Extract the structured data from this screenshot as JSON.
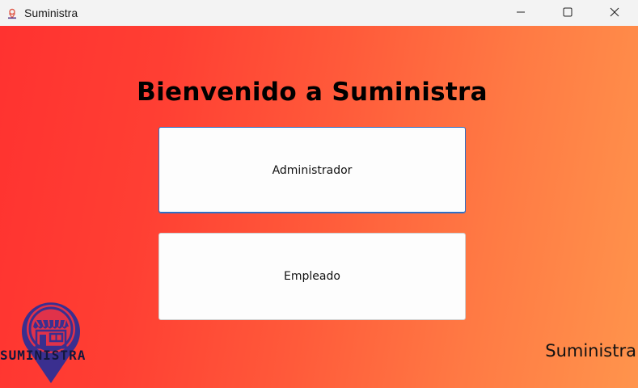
{
  "window": {
    "title": "Suministra",
    "controls": {
      "minimize_icon": "minimize-icon",
      "maximize_icon": "maximize-icon",
      "close_icon": "close-icon"
    }
  },
  "main": {
    "welcome": "Bienvenido a Suministra",
    "buttons": {
      "admin": "Administrador",
      "employee": "Empleado"
    }
  },
  "logo": {
    "text": "SUMINISTRA"
  },
  "brand_footer": "Suministra",
  "colors": {
    "gradient_start": "#ff3230",
    "gradient_end": "#ff944c",
    "logo_primary": "#3a2f8f",
    "logo_accent": "#e0324a"
  }
}
